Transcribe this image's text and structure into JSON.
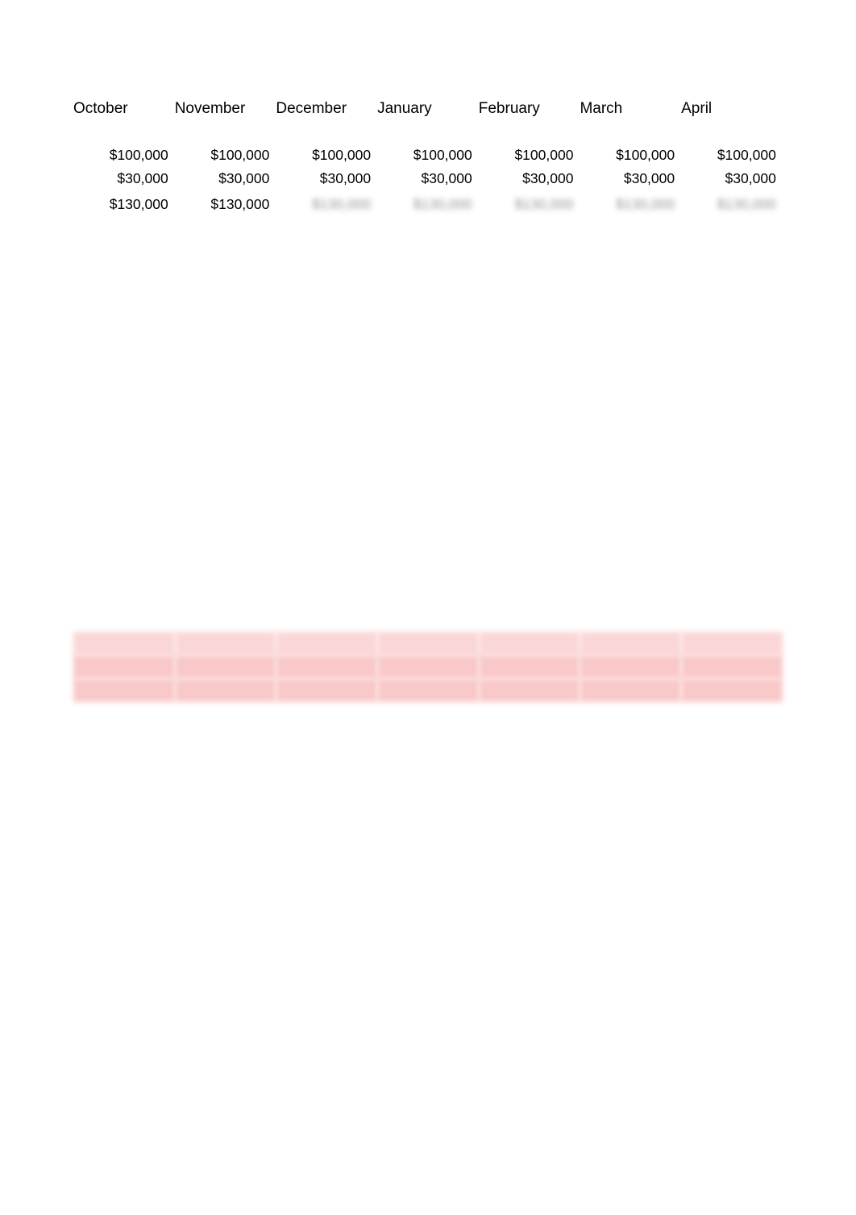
{
  "document": {
    "type": "spreadsheet-financial-table",
    "background_color": "#ffffff",
    "text_color": "#000000",
    "redaction_note": "large portions of the sheet are visually blurred / illegible"
  },
  "colors": {
    "text": "#000000",
    "redacted_text": "#4a4a4a",
    "highlight_background": "#f9c8c8",
    "highlight_text": "#d94a4a"
  },
  "columns": {
    "headers": [
      "October",
      "November",
      "December",
      "January",
      "February",
      "March",
      "April"
    ]
  },
  "section_top": {
    "rows": [
      {
        "name": "row-1",
        "values": [
          "$100,000",
          "$100,000",
          "$100,000",
          "$100,000",
          "$100,000",
          "$100,000",
          "$100,000"
        ],
        "legible": true
      },
      {
        "name": "row-2",
        "values": [
          "$30,000",
          "$30,000",
          "$30,000",
          "$30,000",
          "$30,000",
          "$30,000",
          "$30,000"
        ],
        "legible": true
      },
      {
        "name": "row-3",
        "values": [
          "$130,000",
          "$130,000",
          "$130,000",
          "$130,000",
          "$130,000",
          "$130,000",
          "$130,000"
        ],
        "legible_columns": [
          "October",
          "November"
        ],
        "legible": false
      }
    ]
  },
  "section_middle": {
    "redacted": true,
    "rows": [
      {
        "name": "row-4",
        "values": [
          "",
          "",
          "",
          "",
          "",
          "",
          ""
        ]
      },
      {
        "name": "row-5",
        "values": [
          "",
          "",
          "",
          "",
          "",
          "",
          ""
        ]
      },
      {
        "name": "row-6",
        "values": [
          "",
          "",
          "",
          "",
          "",
          "",
          ""
        ]
      },
      {
        "name": "row-7",
        "values": [
          "",
          "",
          "",
          "",
          "",
          "",
          ""
        ]
      },
      {
        "name": "row-8",
        "values": [
          "",
          "",
          "",
          "",
          "",
          "",
          ""
        ]
      },
      {
        "name": "row-9",
        "values": [
          "",
          "",
          "",
          "",
          "",
          "",
          ""
        ]
      },
      {
        "name": "row-10",
        "values": [
          "",
          "",
          "",
          "",
          "",
          "",
          ""
        ]
      },
      {
        "name": "row-11",
        "values": [
          "",
          "",
          "",
          "",
          "",
          "",
          ""
        ]
      }
    ]
  },
  "section_subtotal": {
    "redacted": true,
    "rows": [
      {
        "name": "row-12",
        "values": [
          "",
          "",
          "",
          "",
          "",
          "",
          ""
        ]
      },
      {
        "name": "row-13",
        "values": [
          "",
          "",
          "",
          "",
          "",
          "",
          ""
        ]
      }
    ]
  },
  "section_highlight": {
    "redacted": true,
    "highlighted": true,
    "lead_row": {
      "name": "row-14",
      "values": [
        "",
        "",
        "",
        "",
        "",
        "",
        ""
      ]
    },
    "rows": [
      {
        "name": "row-15",
        "values": [
          "",
          "",
          "",
          "",
          "",
          "",
          ""
        ]
      },
      {
        "name": "row-16",
        "values": [
          "",
          "",
          "",
          "",
          "",
          "",
          ""
        ]
      },
      {
        "name": "row-17",
        "values": [
          "",
          "",
          "",
          "",
          "",
          "",
          ""
        ]
      }
    ]
  }
}
